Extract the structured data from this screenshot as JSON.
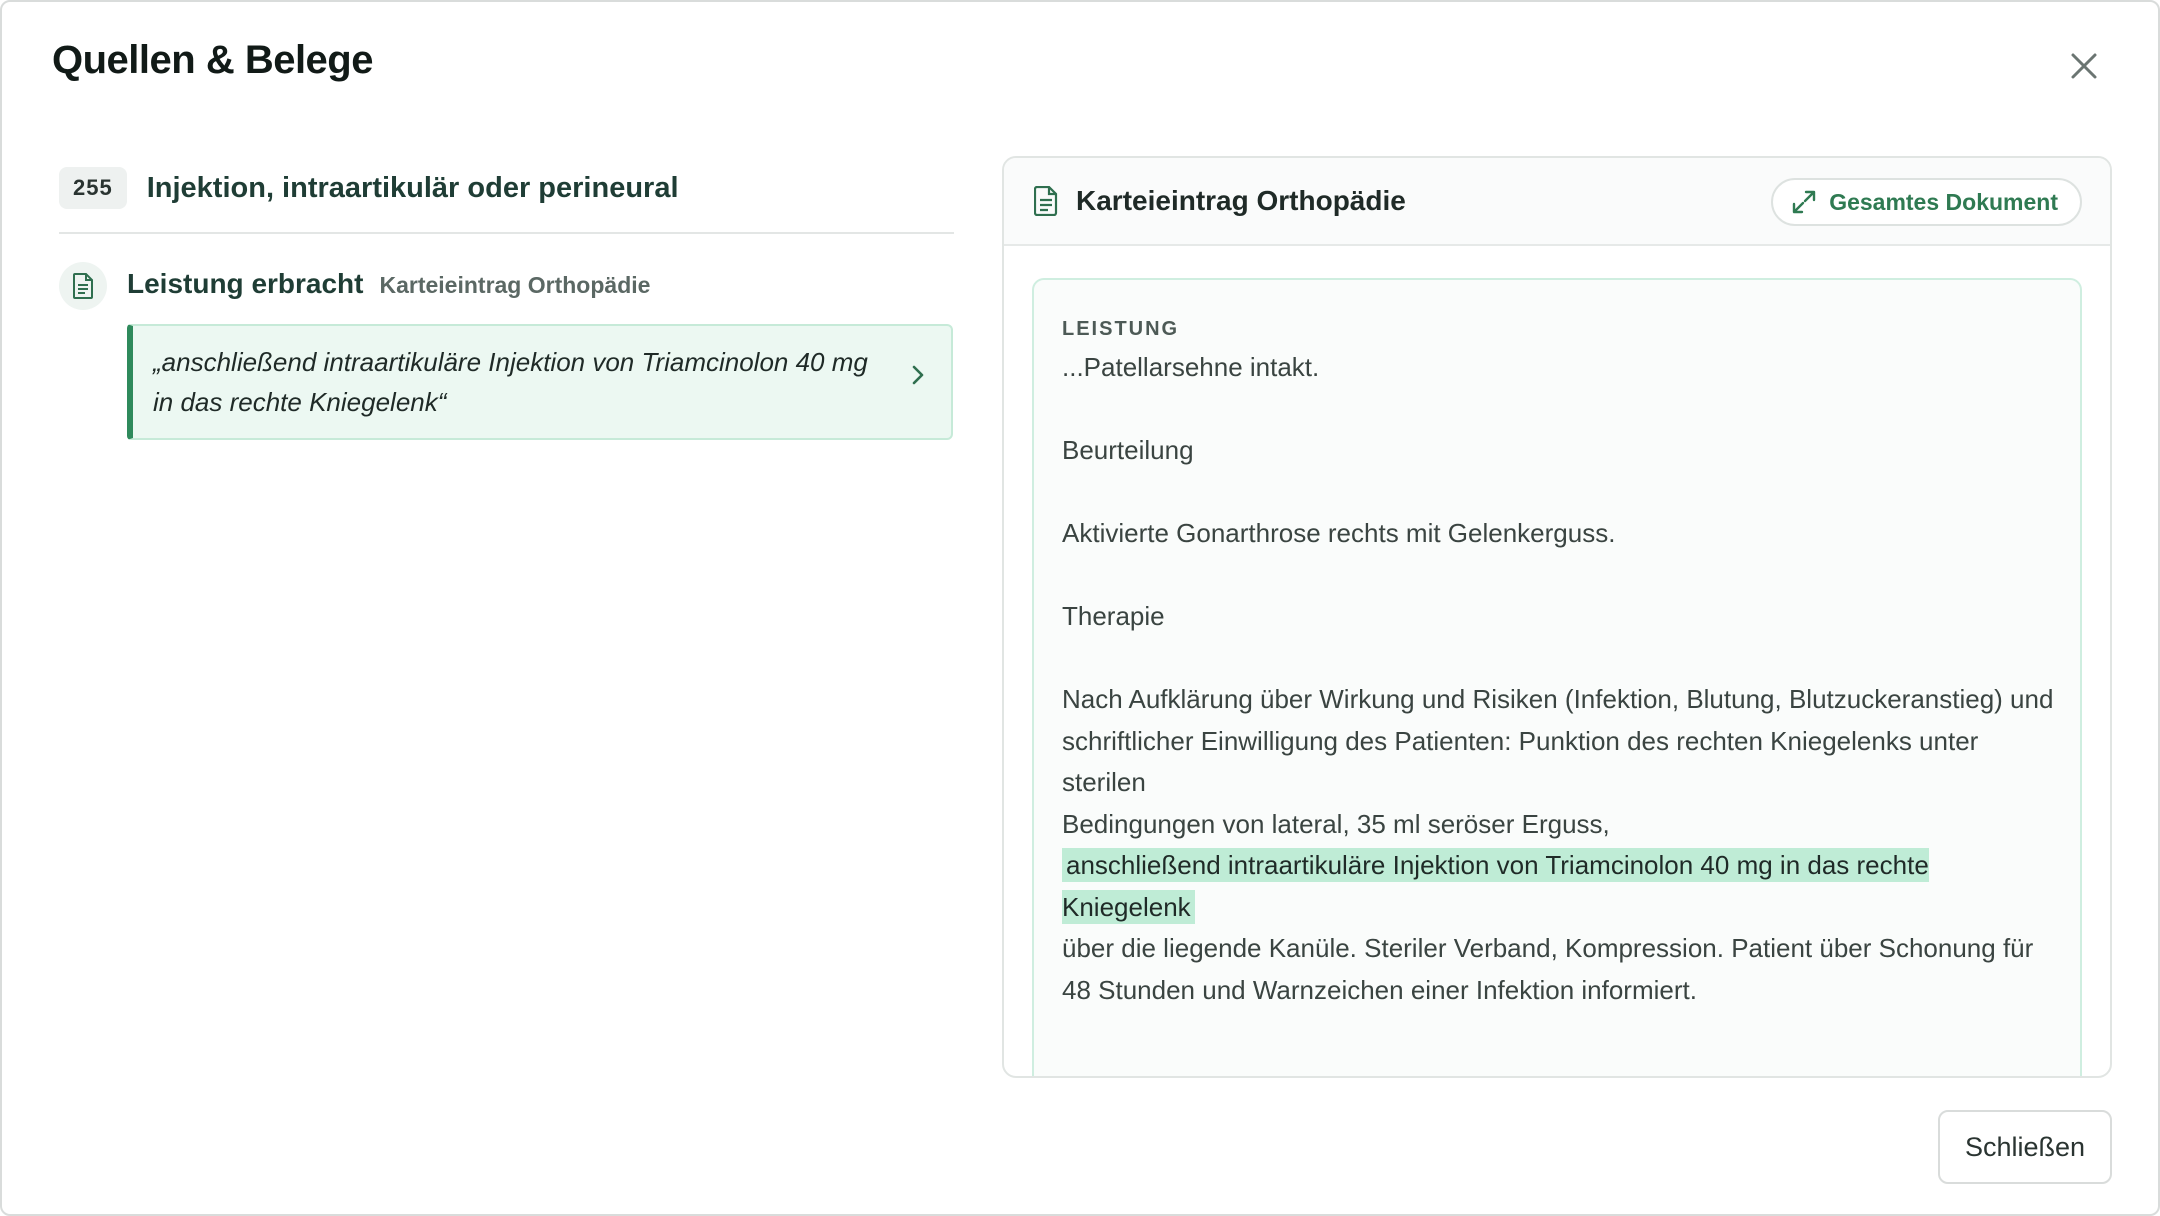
{
  "dialog": {
    "title": "Quellen & Belege",
    "close_icon": "close-icon",
    "footer_close_label": "Schließen"
  },
  "service": {
    "code": "255",
    "title": "Injektion, intraartikulär oder perineural"
  },
  "evidence": {
    "icon": "document-icon",
    "title": "Leistung erbracht",
    "source": "Karteieintrag Orthopädie",
    "quote": "„anschließend intraartikuläre Injektion von Triamcinolon 40 mg in das rechte Kniegelenk“",
    "chevron_icon": "chevron-right-icon"
  },
  "document": {
    "icon": "document-icon",
    "title": "Karteieintrag Orthopädie",
    "full_doc_label": "Gesamtes Dokument",
    "expand_icon": "expand-icon",
    "section_label": "LEISTUNG",
    "lines": [
      "...Patellarsehne intakt.",
      "Beurteilung",
      "Aktivierte Gonarthrose rechts mit Gelenkerguss.",
      "Therapie",
      "Nach Aufklärung über Wirkung und Risiken (Infektion, Blutung, Blutzuckeranstieg) und",
      "schriftlicher Einwilligung des Patienten: Punktion des rechten Kniegelenks unter sterilen",
      "Bedingungen von lateral, 35 ml seröser Erguss,",
      "anschließend intraartikuläre Injektion von Triamcinolon 40 mg in das rechte Kniegelenk",
      "über die liegende Kanüle. Steriler Verband, Kompression. Patient über Schonung für",
      "48 Stunden und Warnzeichen einer Infektion informiert."
    ]
  },
  "colors": {
    "accent": "#2f8a5c",
    "highlight": "#bfecd6",
    "quote_bg": "#ecf8f2"
  }
}
